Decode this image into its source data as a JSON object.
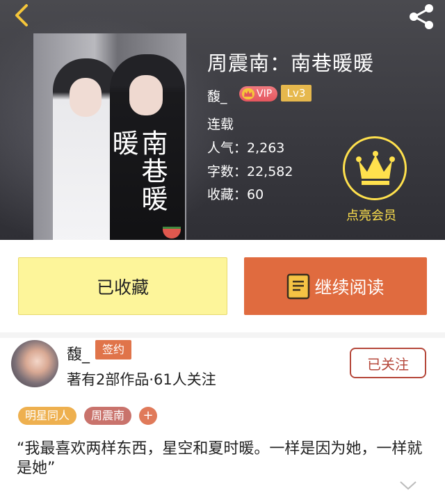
{
  "header": {
    "back_icon": "chevron-left-icon",
    "share_icon": "share-icon"
  },
  "book": {
    "cover_title": "南巷暖暖",
    "title": "周震南：南巷暖暖",
    "author": "馥_",
    "vip_label": "VIP",
    "level": "Lv3",
    "status": "连载",
    "popularity": "人气：2,263",
    "word_count": "字数：22,582",
    "favorites": "收藏：60"
  },
  "membership": {
    "icon": "crown-icon",
    "label": "点亮会员"
  },
  "actions": {
    "collected_label": "已收藏",
    "continue_label": "继续阅读",
    "continue_icon": "book-icon"
  },
  "author_card": {
    "name": "馥_",
    "sign_badge": "签约",
    "stats": "著有2部作品·61人关注",
    "follow_label": "已关注"
  },
  "tags": [
    "明星同人",
    "周震南",
    "+"
  ],
  "synopsis": "“我最喜欢两样东西，星空和夏时暖。一样是因为她，一样就是她”",
  "colors": {
    "accent_orange": "#e06b3f",
    "collected_yellow": "#fdf59a",
    "crown_yellow": "#ffe14d",
    "follow_red": "#b5473a"
  }
}
